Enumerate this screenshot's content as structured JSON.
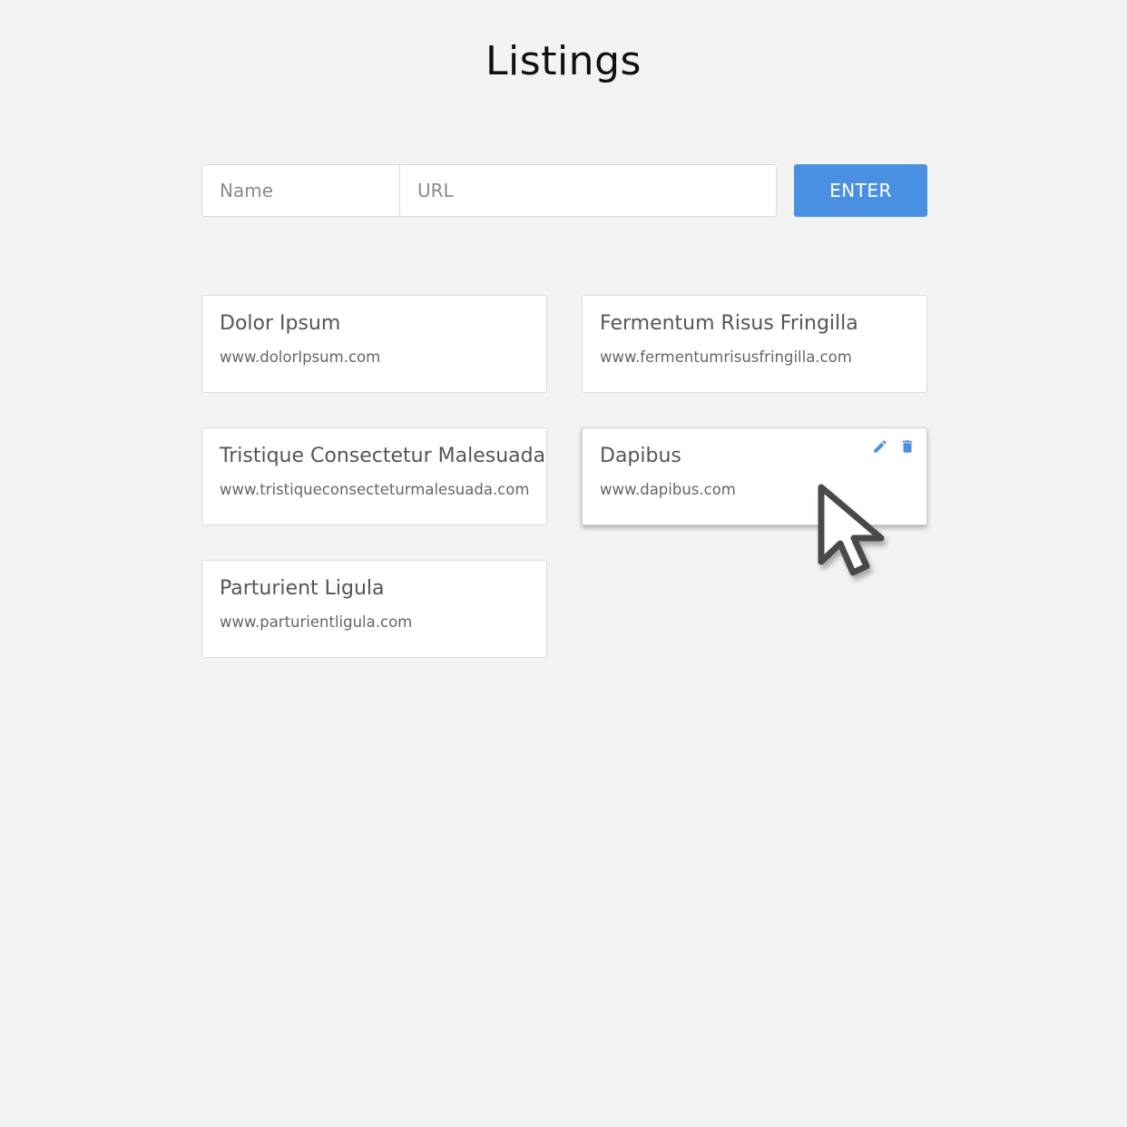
{
  "header": {
    "title": "Listings"
  },
  "form": {
    "name_placeholder": "Name",
    "url_placeholder": "URL",
    "enter_label": "ENTER"
  },
  "listings": [
    {
      "name": "Dolor Ipsum",
      "url": "www.dolorIpsum.com"
    },
    {
      "name": "Fermentum Risus Fringilla",
      "url": "www.fermentumrisusfringilla.com"
    },
    {
      "name": "Tristique Consectetur Malesuada",
      "url": "www.tristiqueconsecteturmalesuada.com"
    },
    {
      "name": "Dapibus",
      "url": "www.dapibus.com"
    },
    {
      "name": "Parturient Ligula",
      "url": "www.parturientligula.com"
    }
  ],
  "card_actions": {
    "edit_icon": "pencil-icon",
    "delete_icon": "trash-icon"
  },
  "colors": {
    "accent": "#4a90e2",
    "background": "#f3f3f3",
    "card": "#ffffff",
    "title_text": "#111111",
    "card_text": "#555555"
  }
}
